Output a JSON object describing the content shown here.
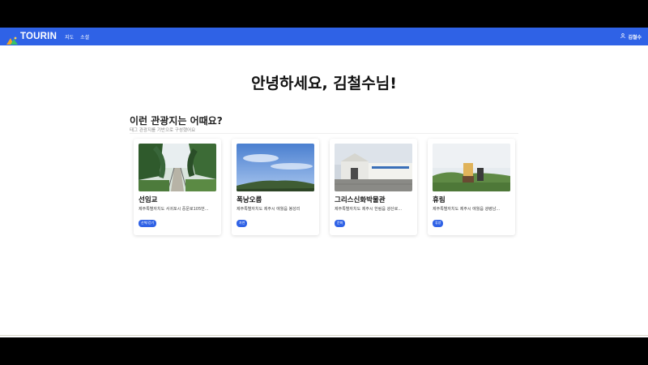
{
  "app": {
    "logo_text": "TOURIN"
  },
  "nav": {
    "links": [
      {
        "label": "지도"
      },
      {
        "label": "소셜"
      }
    ],
    "user_name": "김철수"
  },
  "main": {
    "greeting": "안녕하세요, 김철수님!",
    "section_title": "이런 관광지는 어때요?",
    "section_subtitle": "태그 관광지를 기반으로 구성했어요",
    "cards": [
      {
        "name": "선임교",
        "address": "제주특별자치도 서귀포시 중문로105번...",
        "tag": "산책/걷기",
        "image": "bridge-forest-photo"
      },
      {
        "name": "폭낭오름",
        "address": "제주특별자치도 제주시 애월읍 봉성리",
        "tag": "자연",
        "image": "sky-hill-photo"
      },
      {
        "name": "그리스신화박물관",
        "address": "제주특별자치도 제주시 한림읍 광산로...",
        "tag": "문화",
        "image": "museum-building-photo"
      },
      {
        "name": "휴림",
        "address": "제주특별자치도 제주시 애월읍 광령남...",
        "tag": "휴양",
        "image": "park-sign-photo"
      }
    ]
  },
  "colors": {
    "brand": "#2f62e6",
    "card_bg": "#ffffff",
    "text_primary": "#111111"
  }
}
